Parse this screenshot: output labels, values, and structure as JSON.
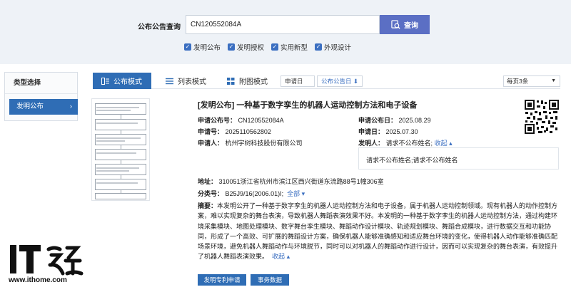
{
  "search": {
    "label": "公布公告查询",
    "value": "CN120552084A",
    "button_label": "查询"
  },
  "filters": [
    {
      "label": "发明公布",
      "checked": true
    },
    {
      "label": "发明授权",
      "checked": true
    },
    {
      "label": "实用新型",
      "checked": true
    },
    {
      "label": "外观设计",
      "checked": true
    }
  ],
  "sidebar": {
    "title": "类型选择",
    "items": [
      {
        "label": "发明公布",
        "arrow": "›"
      }
    ]
  },
  "tabs": [
    {
      "label": "公布模式",
      "active": true
    },
    {
      "label": "列表模式",
      "active": false
    },
    {
      "label": "附图模式",
      "active": false
    }
  ],
  "sort": {
    "option1": "申请日",
    "option2": "公布公告日",
    "option2_arrow": "⬇",
    "per_page": "每页3条",
    "per_page_caret": "▼"
  },
  "record": {
    "title": "[发明公布] 一种基于数字孪生的机器人运动控制方法和电子设备",
    "pub_no_label": "申请公布号：",
    "pub_no": "CN120552084A",
    "pub_date_label": "申请公布日：",
    "pub_date": "2025.08.29",
    "app_no_label": "申请号：",
    "app_no": "2025110562802",
    "app_date_label": "申请日：",
    "app_date": "2025.07.30",
    "applicant_label": "申请人：",
    "applicant": "杭州宇树科技股份有限公司",
    "inventor_label": "发明人：",
    "inventor": "请求不公布姓名;",
    "collapse": "收起",
    "collapse_caret": "▴",
    "inventor_full": "请求不公布姓名;请求不公布姓名",
    "address_label": "地址：",
    "address": "310051浙江省杭州市滨江区西兴街道东流路88号1幢306室",
    "class_label": "分类号：",
    "class_value": "B25J9/16(2006.01)I;",
    "class_all": "全部",
    "class_caret": "▾",
    "abstract_label": "摘要：",
    "abstract": "本发明公开了一种基于数字孪生的机器人运动控制方法和电子设备，属于机器人运动控制领域。现有机器人的动作控制方案，难以实现复杂的舞台表演，导致机器人舞蹈表演效果不好。本发明的一种基于数字孪生的机器人运动控制方法，通过构建环境采集模块、地图处理模块、数字舞台孪生模块、舞蹈动作设计模块、轨迹规划模块、舞蹈合成模块，进行数据交互和功能协同，形成了一个高效、可扩展的舞蹈设计方案，确保机器人能够准确感知和适应舞台环境的变化，使得机器人动作能够准确匹配场景环境，避免机器人舞蹈动作与环境脱节，同时可以对机器人的舞蹈动作进行设计，因而可以实现复杂的舞台表演，有效提升了机器人舞蹈表演效果。",
    "abstract_collapse": "收起",
    "abstract_caret": "▴"
  },
  "buttons": {
    "patent_apply": "发明专利申请",
    "affairs": "事务数据"
  },
  "watermark": {
    "logo_text": "IT之家",
    "url": "www.ithome.com"
  },
  "colors": {
    "accent": "#2f6db5",
    "search_button": "#5b6fc4",
    "link": "#3b6fc1",
    "top_band": "#eef2f7"
  }
}
